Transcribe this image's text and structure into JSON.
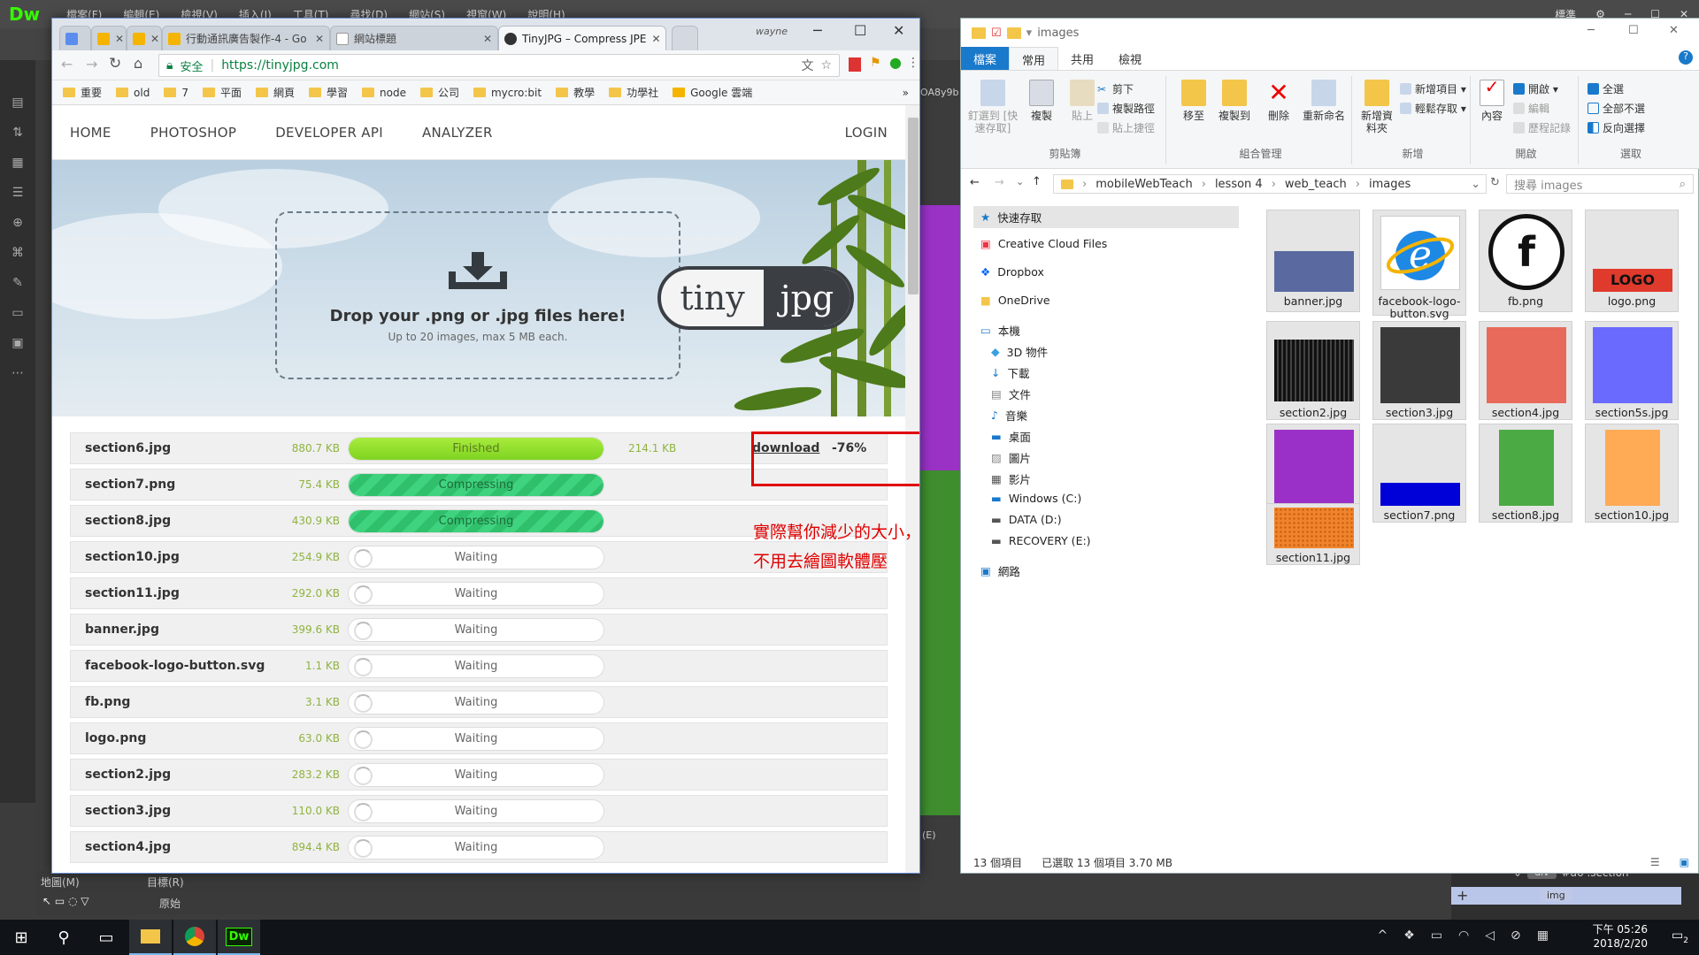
{
  "dw": {
    "menus": [
      "檔案(F)",
      "編輯(E)",
      "檢視(V)",
      "插入(I)",
      "工具(T)",
      "尋找(D)",
      "網站(S)",
      "視窗(W)",
      "說明(H)"
    ],
    "layout": "標準",
    "bottom_left1": "地圖(M)",
    "bottom_left2": "目標(R)",
    "bottom_left3": "原始",
    "breadcrumb_div": "div",
    "breadcrumb_sel": "#a6 .section",
    "tag_img": "img",
    "stray_text": "OA8y9b",
    "stray_e": "(E)"
  },
  "chrome": {
    "profile": "wayne",
    "tabs": [
      {
        "label": "",
        "icon": "page-icon"
      },
      {
        "label": "",
        "icon": "slides-icon"
      },
      {
        "label": "",
        "icon": "slides-icon"
      },
      {
        "label": "行動通訊廣告製作-4 - Go",
        "icon": "slides-icon"
      },
      {
        "label": "網站標題",
        "icon": "page-icon"
      },
      {
        "label": "TinyJPG – Compress JPE",
        "icon": "panda-icon"
      }
    ],
    "secure_label": "安全",
    "url": "https://tinyjpg.com",
    "bookmarks": [
      "重要",
      "old",
      "7",
      "平面",
      "網頁",
      "學習",
      "node",
      "公司",
      "mycro:bit",
      "教學",
      "功學社",
      "Google 雲端"
    ]
  },
  "site": {
    "nav": [
      "HOME",
      "PHOTOSHOP",
      "DEVELOPER API",
      "ANALYZER"
    ],
    "login": "LOGIN",
    "drop_title": "Drop your .png or .jpg files here!",
    "drop_sub": "Up to 20 images, max 5 MB each.",
    "logo_left": "tiny",
    "logo_right": "jpg",
    "files": [
      {
        "name": "section6.jpg",
        "size": "880.7 KB",
        "status": "Finished",
        "state": "finished",
        "progress": 1.0,
        "new_size": "214.1 KB",
        "download": "download",
        "saving": "-76%"
      },
      {
        "name": "section7.png",
        "size": "75.4 KB",
        "status": "Compressing",
        "state": "compressing",
        "progress": 1.0
      },
      {
        "name": "section8.jpg",
        "size": "430.9 KB",
        "status": "Compressing",
        "state": "compressing",
        "progress": 1.0
      },
      {
        "name": "section10.jpg",
        "size": "254.9 KB",
        "status": "Waiting",
        "state": "waiting"
      },
      {
        "name": "section11.jpg",
        "size": "292.0 KB",
        "status": "Waiting",
        "state": "waiting"
      },
      {
        "name": "banner.jpg",
        "size": "399.6 KB",
        "status": "Waiting",
        "state": "waiting"
      },
      {
        "name": "facebook-logo-button.svg",
        "size": "1.1 KB",
        "status": "Waiting",
        "state": "waiting"
      },
      {
        "name": "fb.png",
        "size": "3.1 KB",
        "status": "Waiting",
        "state": "waiting"
      },
      {
        "name": "logo.png",
        "size": "63.0 KB",
        "status": "Waiting",
        "state": "waiting"
      },
      {
        "name": "section2.jpg",
        "size": "283.2 KB",
        "status": "Waiting",
        "state": "waiting"
      },
      {
        "name": "section3.jpg",
        "size": "110.0 KB",
        "status": "Waiting",
        "state": "waiting"
      },
      {
        "name": "section4.jpg",
        "size": "894.4 KB",
        "status": "Waiting",
        "state": "waiting"
      }
    ],
    "annotation": "實際幫你減少的大小，所以不用去繪圖軟體壓"
  },
  "explorer": {
    "title": "images",
    "tabs": [
      "檔案",
      "常用",
      "共用",
      "檢視"
    ],
    "ribbon": {
      "clipboard": {
        "pin": "釘選到 [快速存取]",
        "copy": "複製",
        "paste": "貼上",
        "cut": "剪下",
        "copy_path": "複製路徑",
        "paste_shortcut": "貼上捷徑",
        "label": "剪貼簿"
      },
      "organize": {
        "move": "移至",
        "copy_to": "複製到",
        "delete": "刪除",
        "rename": "重新命名",
        "label": "組合管理"
      },
      "new": {
        "folder": "新增資料夾",
        "new_item": "新增項目 ▾",
        "easy_access": "輕鬆存取 ▾",
        "label": "新增"
      },
      "open": {
        "properties": "內容",
        "open": "開啟 ▾",
        "edit": "編輯",
        "history": "歷程記錄",
        "label": "開啟"
      },
      "select": {
        "all": "全選",
        "none": "全部不選",
        "invert": "反向選擇",
        "label": "選取"
      }
    },
    "path": [
      "mobileWebTeach",
      "lesson 4",
      "web_teach",
      "images"
    ],
    "search_placeholder": "搜尋 images",
    "nav": [
      "快速存取",
      "Creative Cloud Files",
      "Dropbox",
      "OneDrive",
      "本機",
      "3D 物件",
      "下載",
      "文件",
      "音樂",
      "桌面",
      "圖片",
      "影片",
      "Windows (C:)",
      "DATA (D:)",
      "RECOVERY (E:)",
      "網路"
    ],
    "files": [
      {
        "name": "banner.jpg",
        "color": "#5a6aa0"
      },
      {
        "name": "facebook-logo-button.svg",
        "color": "#ffffff"
      },
      {
        "name": "fb.png",
        "color": "#ffffff"
      },
      {
        "name": "logo.png",
        "color": "#e03a2c"
      },
      {
        "name": "section2.jpg",
        "color": "#1a1a1a"
      },
      {
        "name": "section3.jpg",
        "color": "#3a3a3a"
      },
      {
        "name": "section4.jpg",
        "color": "#e86a5a"
      },
      {
        "name": "section5s.jpg",
        "color": "#6a6aff"
      },
      {
        "name": "section6.jpg",
        "color": "#9b30c8"
      },
      {
        "name": "section7.png",
        "color": "#0000d8"
      },
      {
        "name": "section8.jpg",
        "color": "#4caa44"
      },
      {
        "name": "section10.jpg",
        "color": "#ffaa55"
      },
      {
        "name": "section11.jpg",
        "color": "#f0842c"
      }
    ],
    "logo_text": "LOGO",
    "fb_text": "f",
    "status_count": "13 個項目",
    "status_selected": "已選取 13 個項目  3.70 MB"
  },
  "taskbar": {
    "time": "下午 05:26",
    "date": "2018/2/20",
    "notif_count": "2"
  }
}
